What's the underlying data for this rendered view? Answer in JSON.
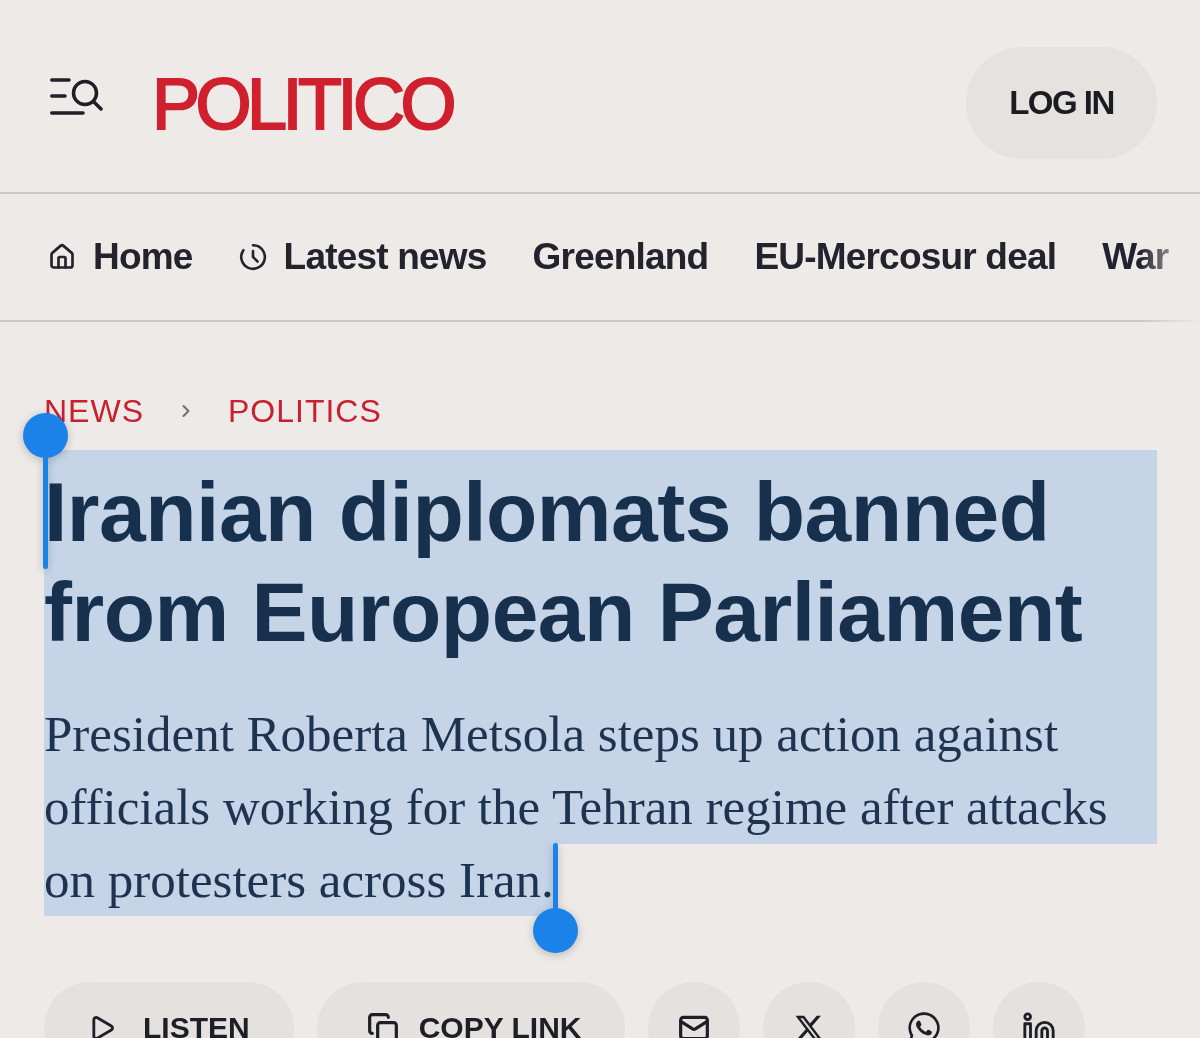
{
  "header": {
    "logo": "POLITICO",
    "login_button": "LOG IN"
  },
  "nav": {
    "items": [
      {
        "kind": "home",
        "label": "Home"
      },
      {
        "kind": "latest",
        "label": "Latest news"
      },
      {
        "kind": "topic",
        "label": "Greenland"
      },
      {
        "kind": "topic",
        "label": "EU-Mercosur deal"
      },
      {
        "kind": "topic",
        "label": "War"
      }
    ]
  },
  "breadcrumb": [
    {
      "label": "NEWS"
    },
    {
      "label": "POLITICS"
    }
  ],
  "headline": {
    "text": "Iranian diplomats banned from European Parliament",
    "selected": true
  },
  "dek": {
    "text": "President Roberta Metsola steps up action against officials working for the Tehran regime after attacks on protesters across Iran.",
    "selected": true
  },
  "share_bar": {
    "buttons": [
      {
        "kind": "listen",
        "label": "LISTEN"
      },
      {
        "kind": "copy_link",
        "label": "COPY LINK"
      },
      {
        "kind": "email"
      },
      {
        "kind": "x"
      },
      {
        "kind": "whatsapp"
      },
      {
        "kind": "linkedin"
      }
    ]
  }
}
